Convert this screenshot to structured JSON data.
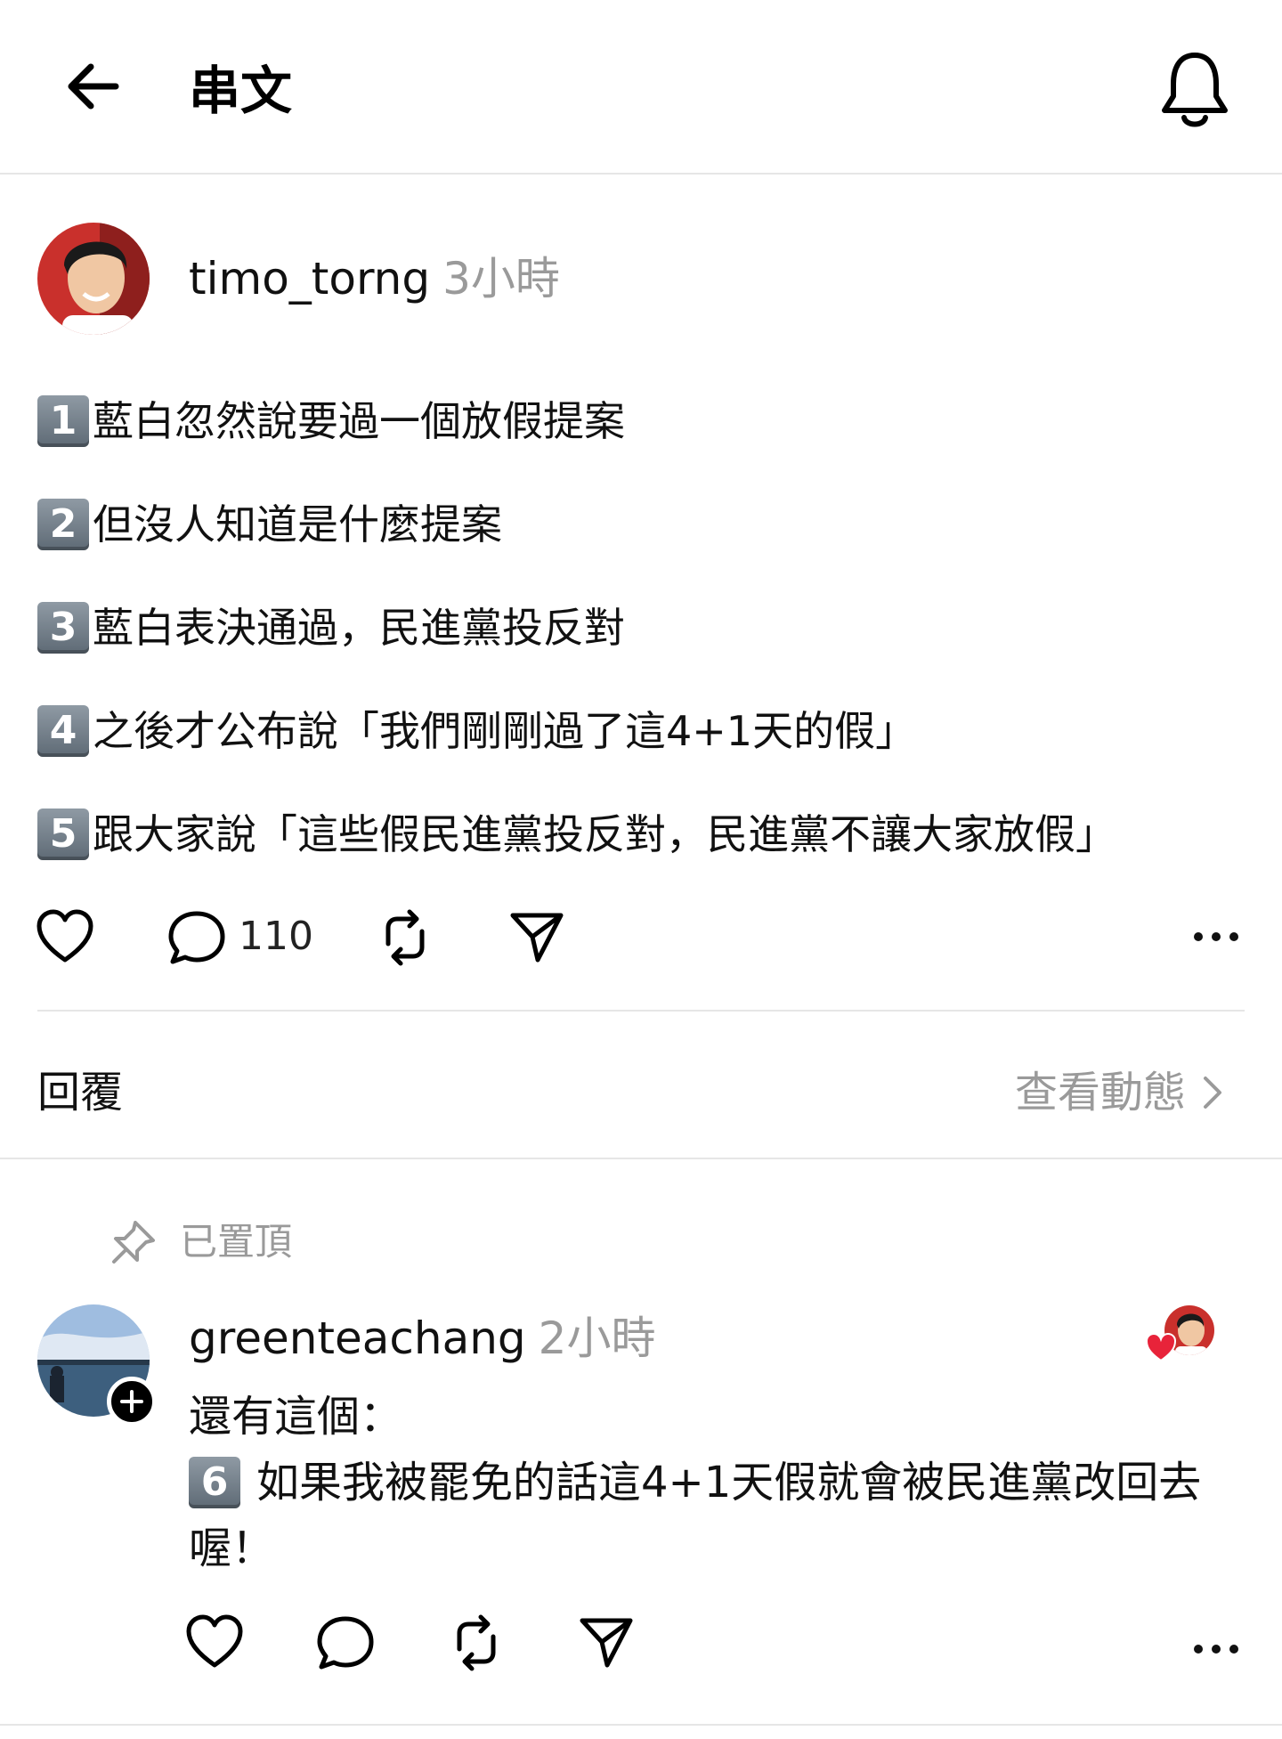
{
  "header": {
    "title": "串文",
    "back_icon": "back-arrow-icon",
    "bell_icon": "bell-icon"
  },
  "post": {
    "username": "timo_torng",
    "time": "3小時",
    "lines": [
      {
        "num": "1",
        "text": "藍白忽然說要過一個放假提案"
      },
      {
        "num": "2",
        "text": "但沒人知道是什麼提案"
      },
      {
        "num": "3",
        "text": "藍白表決通過，民進黨投反對"
      },
      {
        "num": "4",
        "text": "之後才公布說「我們剛剛過了這4+1天的假」"
      },
      {
        "num": "5",
        "text": "跟大家說「這些假民進黨投反對，民進黨不讓大家放假」"
      }
    ],
    "reply_count": "110"
  },
  "replies_section": {
    "label": "回覆",
    "activity_link": "查看動態"
  },
  "pinned_reply": {
    "pinned_label": "已置頂",
    "username": "greenteachang",
    "time": "2小時",
    "line1": "還有這個：",
    "keycap": "6",
    "line2": "如果我被罷免的話這4+1天假就會被民進黨改回去",
    "line3": "喔！"
  },
  "colors": {
    "muted": "#9a9a9a",
    "heart_red": "#e8233a",
    "divider": "#e6e6e6"
  }
}
